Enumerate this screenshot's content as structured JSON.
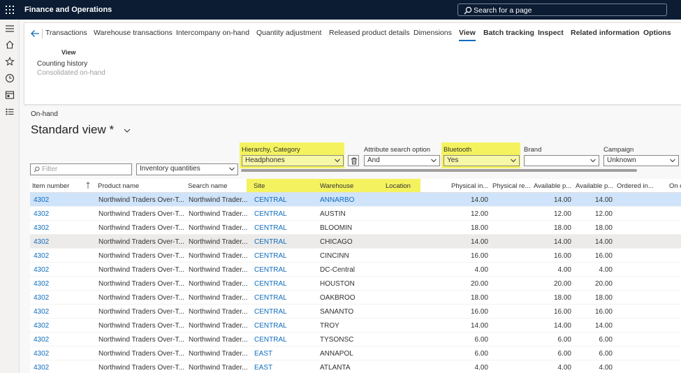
{
  "app": {
    "title": "Finance and Operations"
  },
  "search": {
    "placeholder": "Search for a page"
  },
  "action_pane": {
    "tabs": [
      {
        "label": "Transactions"
      },
      {
        "label": "Warehouse transactions"
      },
      {
        "label": "Intercompany on-hand"
      },
      {
        "label": "Quantity adjustment"
      },
      {
        "label": "Released product details"
      },
      {
        "label": "Dimensions"
      },
      {
        "label": "View"
      },
      {
        "label": "Batch tracking"
      },
      {
        "label": "Inspect"
      },
      {
        "label": "Related information"
      },
      {
        "label": "Options"
      }
    ],
    "group_title": "View",
    "items": [
      "Counting history",
      "Consolidated on-hand"
    ]
  },
  "page": {
    "caption": "On-hand",
    "title": "Standard view *"
  },
  "filters": {
    "filter_placeholder": "Filter",
    "inventory_select": "Inventory quantities",
    "hierarchy_label": "Hierarchy, Category",
    "hierarchy_value": "Headphones",
    "attr_search_label": "Attribute search option",
    "attr_search_value": "And",
    "bluetooth_label": "Bluetooth",
    "bluetooth_value": "Yes",
    "brand_label": "Brand",
    "brand_value": "",
    "campaign_label": "Campaign",
    "campaign_value": "Unknown"
  },
  "grid": {
    "columns": [
      "Item number",
      "Product name",
      "Search name",
      "Site",
      "Warehouse",
      "Location",
      "Physical in...",
      "Physical re...",
      "Available p...",
      "Available p...",
      "Ordered in...",
      "On o"
    ],
    "rows": [
      {
        "item": "4302",
        "product": "Northwind Traders Over-T...",
        "search": "Northwind Trader...",
        "site": "CENTRAL",
        "warehouse": "ANNARBO",
        "phys": "14.00",
        "avail1": "14.00",
        "avail2": "14.00"
      },
      {
        "item": "4302",
        "product": "Northwind Traders Over-T...",
        "search": "Northwind Trader...",
        "site": "CENTRAL",
        "warehouse": "AUSTIN",
        "phys": "12.00",
        "avail1": "12.00",
        "avail2": "12.00"
      },
      {
        "item": "4302",
        "product": "Northwind Traders Over-T...",
        "search": "Northwind Trader...",
        "site": "CENTRAL",
        "warehouse": "BLOOMIN",
        "phys": "18.00",
        "avail1": "18.00",
        "avail2": "18.00"
      },
      {
        "item": "4302",
        "product": "Northwind Traders Over-T...",
        "search": "Northwind Trader...",
        "site": "CENTRAL",
        "warehouse": "CHICAGO",
        "phys": "14.00",
        "avail1": "14.00",
        "avail2": "14.00"
      },
      {
        "item": "4302",
        "product": "Northwind Traders Over-T...",
        "search": "Northwind Trader...",
        "site": "CENTRAL",
        "warehouse": "CINCINN",
        "phys": "16.00",
        "avail1": "16.00",
        "avail2": "16.00"
      },
      {
        "item": "4302",
        "product": "Northwind Traders Over-T...",
        "search": "Northwind Trader...",
        "site": "CENTRAL",
        "warehouse": "DC-Central",
        "phys": "4.00",
        "avail1": "4.00",
        "avail2": "4.00"
      },
      {
        "item": "4302",
        "product": "Northwind Traders Over-T...",
        "search": "Northwind Trader...",
        "site": "CENTRAL",
        "warehouse": "HOUSTON",
        "phys": "20.00",
        "avail1": "20.00",
        "avail2": "20.00"
      },
      {
        "item": "4302",
        "product": "Northwind Traders Over-T...",
        "search": "Northwind Trader...",
        "site": "CENTRAL",
        "warehouse": "OAKBROO",
        "phys": "18.00",
        "avail1": "18.00",
        "avail2": "18.00"
      },
      {
        "item": "4302",
        "product": "Northwind Traders Over-T...",
        "search": "Northwind Trader...",
        "site": "CENTRAL",
        "warehouse": "SANANTO",
        "phys": "16.00",
        "avail1": "16.00",
        "avail2": "16.00"
      },
      {
        "item": "4302",
        "product": "Northwind Traders Over-T...",
        "search": "Northwind Trader...",
        "site": "CENTRAL",
        "warehouse": "TROY",
        "phys": "14.00",
        "avail1": "14.00",
        "avail2": "14.00"
      },
      {
        "item": "4302",
        "product": "Northwind Traders Over-T...",
        "search": "Northwind Trader...",
        "site": "CENTRAL",
        "warehouse": "TYSONSC",
        "phys": "6.00",
        "avail1": "6.00",
        "avail2": "6.00"
      },
      {
        "item": "4302",
        "product": "Northwind Traders Over-T...",
        "search": "Northwind Trader...",
        "site": "EAST",
        "warehouse": "ANNAPOL",
        "phys": "6.00",
        "avail1": "6.00",
        "avail2": "6.00"
      },
      {
        "item": "4302",
        "product": "Northwind Traders Over-T...",
        "search": "Northwind Trader...",
        "site": "EAST",
        "warehouse": "ATLANTA",
        "phys": "4.00",
        "avail1": "4.00",
        "avail2": "4.00"
      }
    ]
  },
  "colors": {
    "topbar": "#0b1c33",
    "link": "#0f6cbd",
    "highlight": "#f4f35f",
    "selected_row": "#cfe4fa"
  },
  "icons": [
    "waffle-icon",
    "search-icon",
    "hamburger-icon",
    "home-icon",
    "star-icon",
    "clock-icon",
    "workspace-icon",
    "list-icon",
    "back-arrow-icon",
    "chevron-down-icon",
    "filter-icon",
    "trash-icon",
    "sort-arrow-icon"
  ]
}
